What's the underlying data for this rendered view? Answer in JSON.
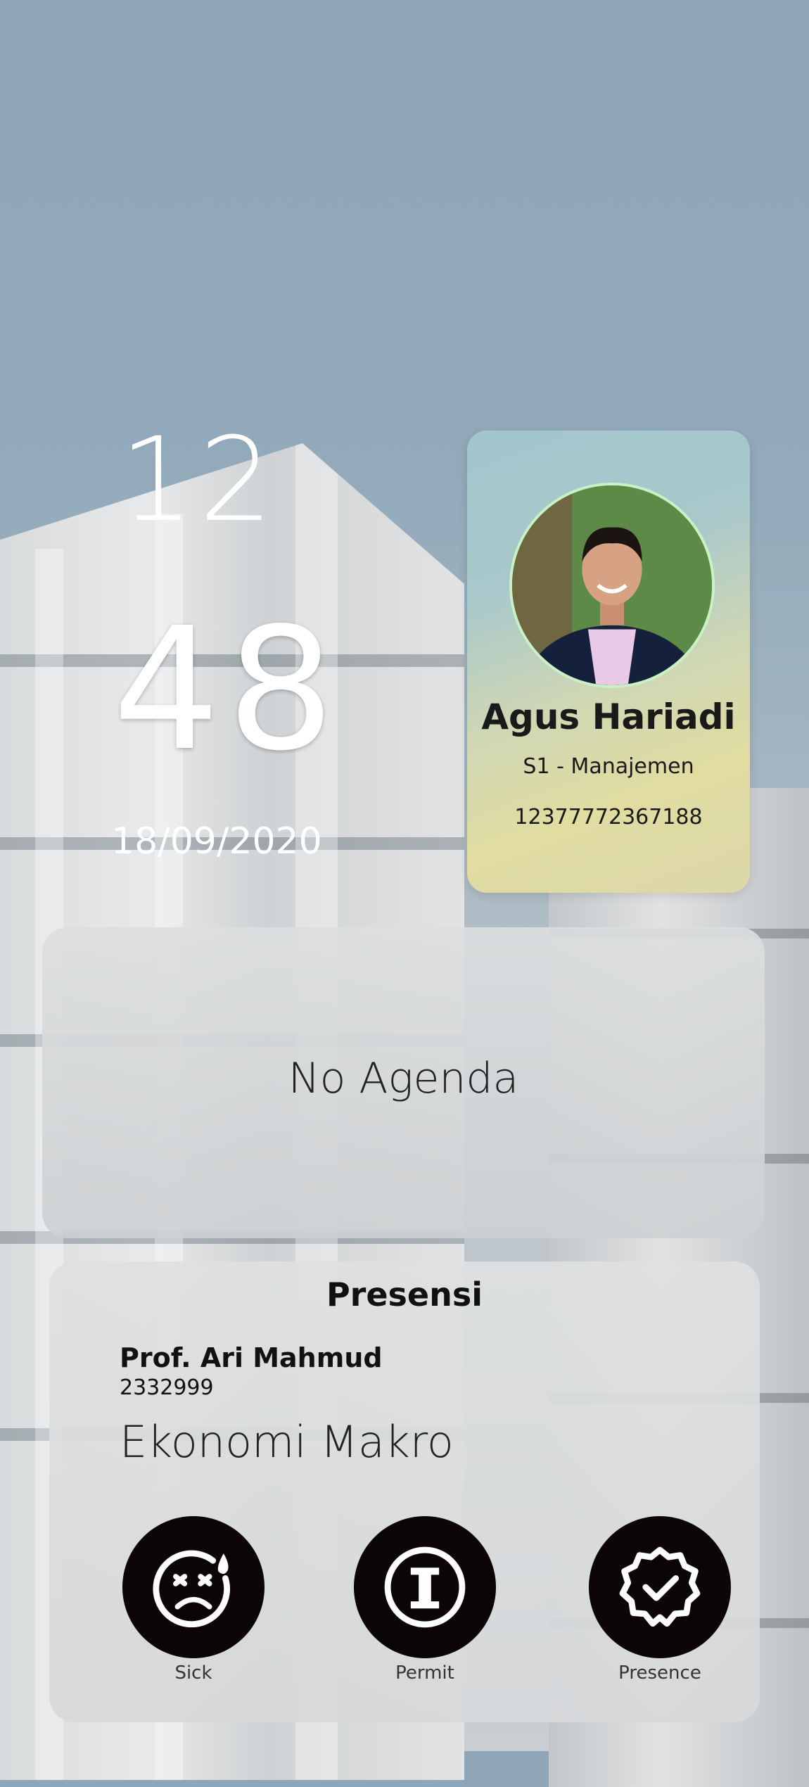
{
  "clock": {
    "hour": "12",
    "minute": "48",
    "date": "18/09/2020"
  },
  "profile": {
    "name": "Agus Hariadi",
    "program": "S1 - Manajemen",
    "student_id": "12377772367188",
    "avatar_icon": "person-photo"
  },
  "agenda": {
    "empty_text": "No Agenda"
  },
  "presensi": {
    "title": "Presensi",
    "lecturer_name": "Prof. Ari Mahmud",
    "lecturer_id": "2332999",
    "course": "Ekonomi Makro",
    "actions": [
      {
        "label": "Sick",
        "icon": "sick-face-icon"
      },
      {
        "label": "Permit",
        "icon": "info-circle-icon"
      },
      {
        "label": "Presence",
        "icon": "verified-badge-icon"
      }
    ]
  },
  "colors": {
    "action_circle": "#0b0505",
    "avatar_border": "#c9f1c6",
    "profile_gradient_top": "#a2c6cc",
    "profile_gradient_bottom": "#e0dca2"
  }
}
